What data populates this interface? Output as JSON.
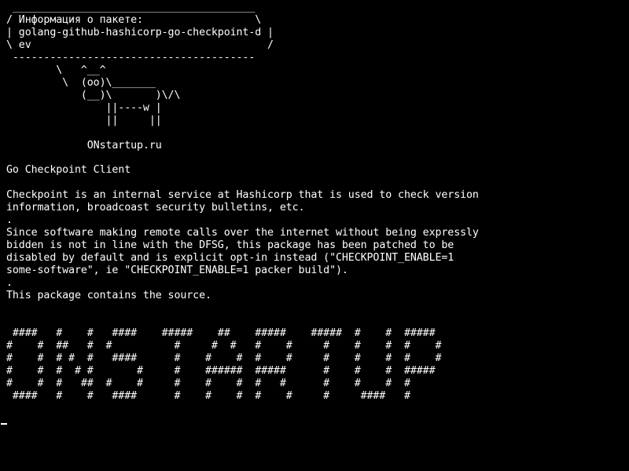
{
  "terminal": {
    "background": "#000000",
    "foreground": "#ffffff",
    "cowsay_art": " _______________________________________\n/ Информация о пакете:                  \\\n| golang-github-hashicorp-go-checkpoint-d |\n\\ ev                                      /\n ---------------------------------------\n        \\   ^__^\n         \\  (oo)\\_______\n            (__)\\       )\\/\\\n                ||----w |\n                ||     ||\n\n             ONstartup.ru",
    "package_title": "Go Checkpoint Client",
    "description": "Checkpoint is an internal service at Hashicorp that is used to check version\ninformation, broadcoast security bulletins, etc.\n.\nSince software making remote calls over the internet without being expressly\nbidden is not in line with the DFSG, this package has been patched to be\ndisabled by default and is explicit opt-in instead (\"CHECKPOINT_ENABLE=1\nsome-software\", ie \"CHECKPOINT_ENABLE=1 packer build\").\n.\nThis package contains the source.",
    "banner_art": " ####   #    #   ####    #####    ##    #####    #####  #    #  #####\n#    #  ##   #  #          #     #  #   #    #     #    #    #  #    #\n#    #  # #  #   ####      #    #    #  #    #     #    #    #  #    #\n#    #  #  # #       #     #    ######  #####      #    #    #  #####\n#    #  #   ##  #    #     #    #    #  #   #      #    #    #  #\n ####   #    #   ####      #    #    #  #    #     #     ####   #"
  }
}
